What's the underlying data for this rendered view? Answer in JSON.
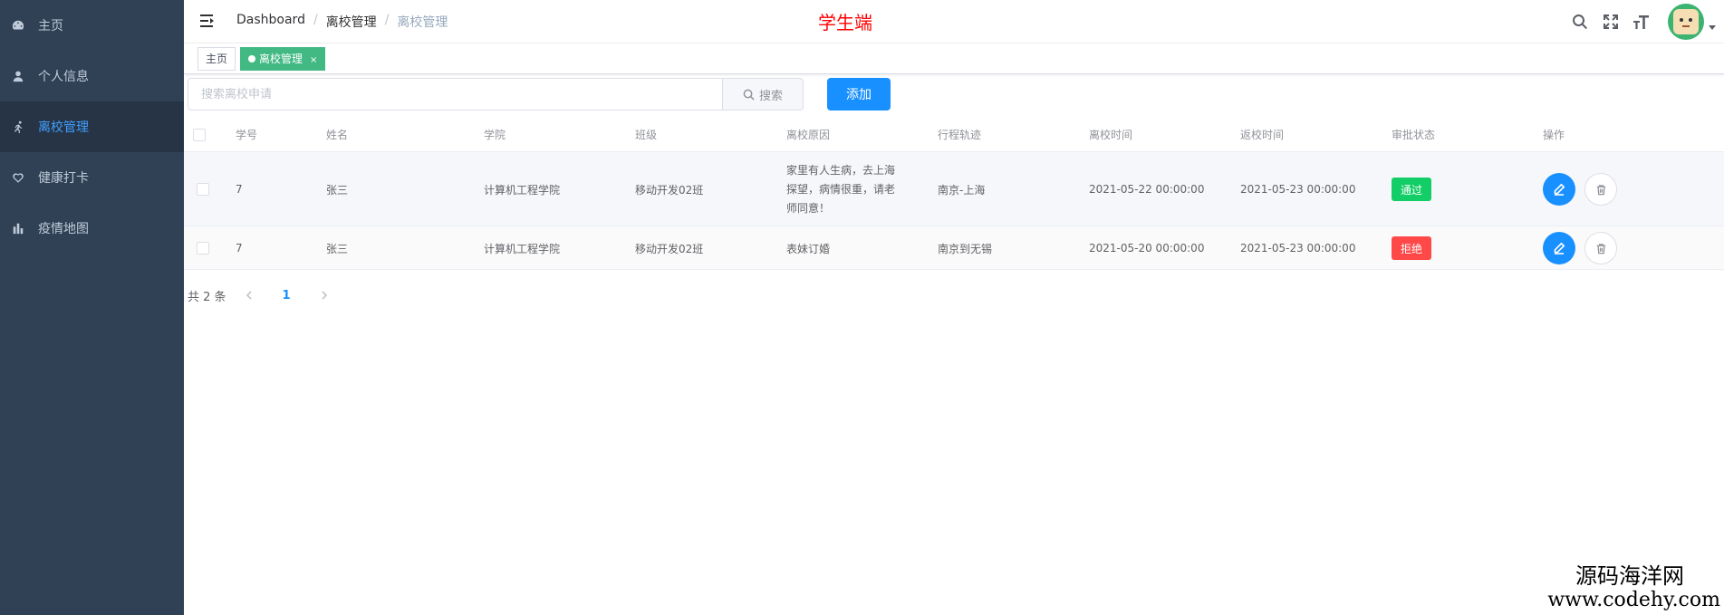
{
  "sidebar": {
    "items": [
      {
        "label": "主页",
        "icon": "dashboard-icon"
      },
      {
        "label": "个人信息",
        "icon": "user-icon"
      },
      {
        "label": "离校管理",
        "icon": "running-icon",
        "active": true
      },
      {
        "label": "健康打卡",
        "icon": "heart-icon"
      },
      {
        "label": "疫情地图",
        "icon": "bar-chart-icon"
      }
    ]
  },
  "navbar": {
    "breadcrumb": [
      "Dashboard",
      "离校管理",
      "离校管理"
    ],
    "title": "学生端",
    "title_color": "#ff0000"
  },
  "tags": {
    "home": "主页",
    "active": "离校管理",
    "close": "×"
  },
  "toolbar": {
    "search_placeholder": "搜索离校申请",
    "search_label": "搜索",
    "add_label": "添加"
  },
  "table": {
    "columns": [
      "学号",
      "姓名",
      "学院",
      "班级",
      "离校原因",
      "行程轨迹",
      "离校时间",
      "返校时间",
      "审批状态",
      "操作"
    ],
    "rows": [
      {
        "id": "7",
        "name": "张三",
        "college": "计算机工程学院",
        "class": "移动开发02班",
        "reason": "家里有人生病，去上海探望，病情很重，请老师同意！",
        "route": "南京-上海",
        "leave_time": "2021-05-22 00:00:00",
        "return_time": "2021-05-23 00:00:00",
        "status": "通过",
        "status_color": "#13ce66"
      },
      {
        "id": "7",
        "name": "张三",
        "college": "计算机工程学院",
        "class": "移动开发02班",
        "reason": "表妹订婚",
        "route": "南京到无锡",
        "leave_time": "2021-05-20 00:00:00",
        "return_time": "2021-05-23 00:00:00",
        "status": "拒绝",
        "status_color": "#ff4949"
      }
    ]
  },
  "pagination": {
    "total_text": "共 2 条",
    "current_page": "1"
  },
  "watermark": {
    "name": "源码海洋网",
    "url": "www.codehy.com"
  },
  "colors": {
    "sidebar_bg": "#304156",
    "accent": "#1890ff",
    "tag_active": "#42b983"
  }
}
